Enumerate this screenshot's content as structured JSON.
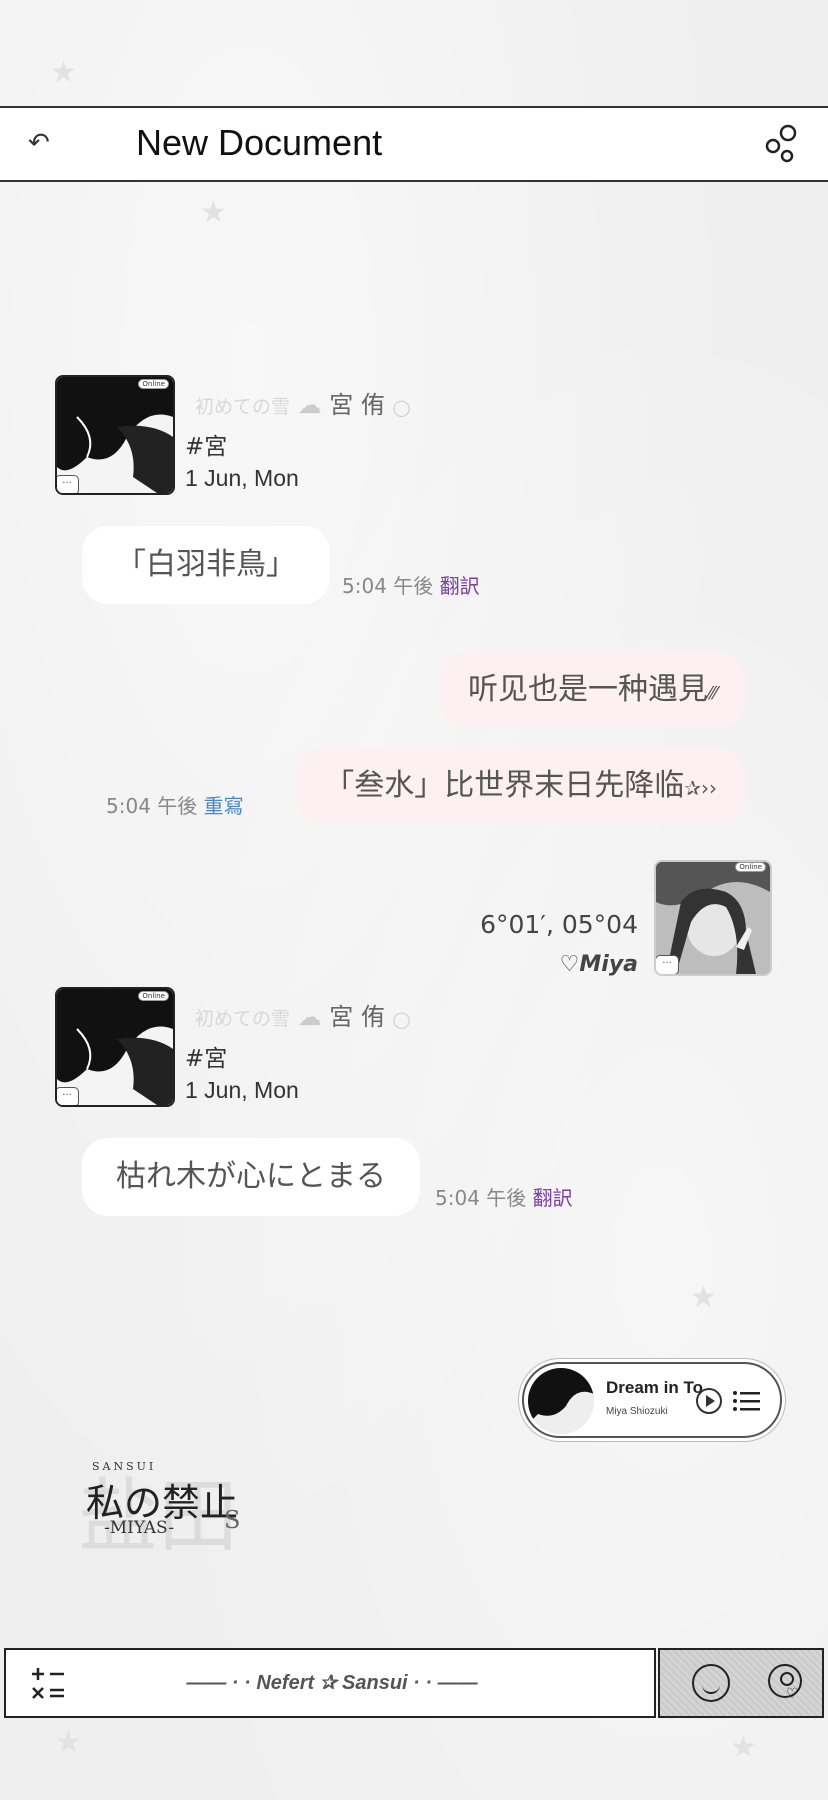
{
  "header": {
    "title": "New Document"
  },
  "profile_1": {
    "ghost_text": "初めての雪",
    "name": "宮 侑",
    "online": "Online",
    "tag": "#宮",
    "date": "1 Jun, Mon"
  },
  "messages": {
    "m1": {
      "text": "「白羽非鳥」",
      "time": "5:04 午後",
      "action": "翻訳"
    },
    "m2": {
      "text": "听见也是一种遇見",
      "deco": "⁄⁄⁄"
    },
    "m3": {
      "text": "「叁水」比世界末日先降临",
      "deco": "✰››",
      "time": "5:04 午後",
      "action": "重寫"
    },
    "m4": {
      "text": "枯れ木が心にとまる",
      "time": "5:04 午後",
      "action": "翻訳"
    }
  },
  "user_right": {
    "online": "Online",
    "coords": "6°01′, 05°04",
    "name": "♡Miya"
  },
  "profile_2": {
    "ghost_text": "初めての雪",
    "name": "宮 侑",
    "online": "Online",
    "tag": "#宮",
    "date": "1 Jun, Mon"
  },
  "player": {
    "title": "Dream in To",
    "artist": "Miya Shiozuki"
  },
  "logo": {
    "top": "SANSUI",
    "main": "私の禁止",
    "sub": "-MIYAS-",
    "s": "S",
    "ghost": "盐田"
  },
  "bottom_bar": {
    "calculator": "+−\n×=",
    "label": "—— · · Nefert ✰ Sansui · · ——"
  },
  "colors": {
    "background": "#efefef",
    "incoming_bubble": "#ffffff",
    "outgoing_bubble": "#fdf0f3",
    "translate_link": "#7a3fa1",
    "rewrite_link": "#4a86c8"
  }
}
